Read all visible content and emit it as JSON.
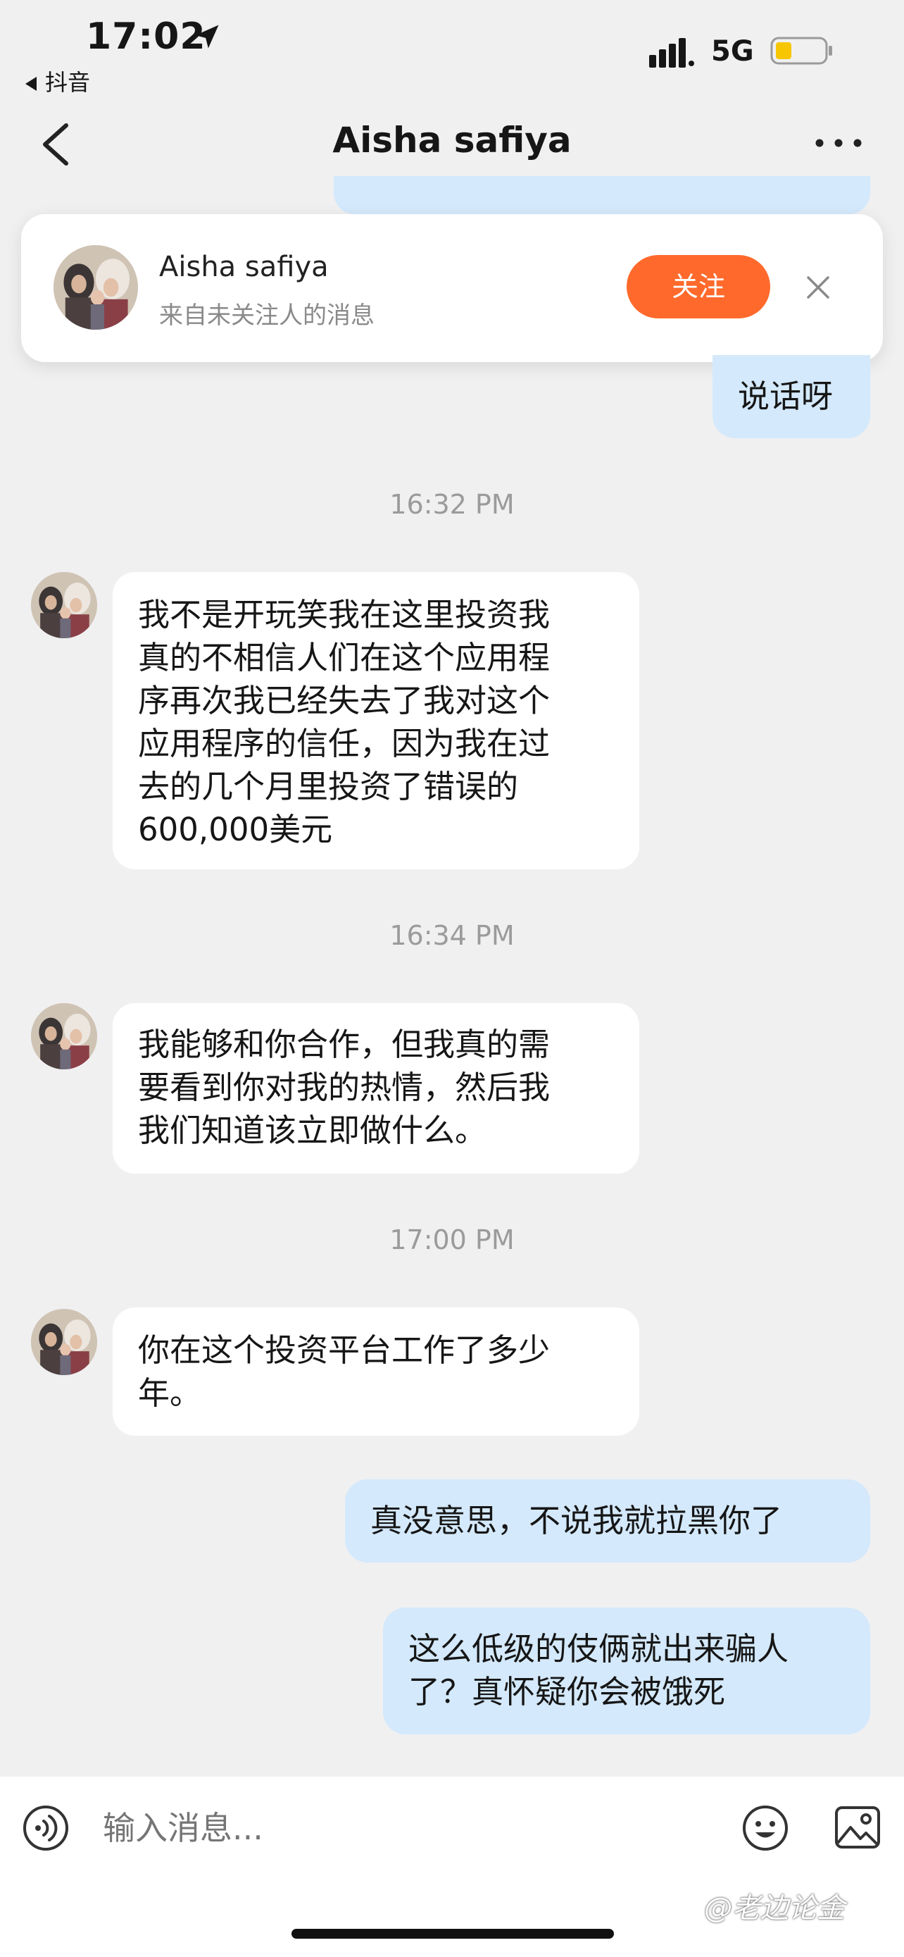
{
  "status_bar": {
    "time": "17:02",
    "back_to_app": "抖音",
    "network": "5G",
    "icons": [
      "location-arrow-icon",
      "signal-icon",
      "battery-icon"
    ]
  },
  "nav": {
    "title": "Aisha safiya",
    "icons": [
      "back-chevron-icon",
      "more-dots-icon"
    ]
  },
  "banner": {
    "name": "Aisha safiya",
    "subtitle": "来自未关注人的消息",
    "follow_label": "关注"
  },
  "messages": [
    {
      "type": "outgoing",
      "text": "说话呀"
    },
    {
      "type": "timestamp",
      "text": "16:32 PM"
    },
    {
      "type": "incoming",
      "text": "我不是开玩笑我在这里投资我\n真的不相信人们在这个应用程\n序再次我已经失去了我对这个\n应用程序的信任，因为我在过\n去的几个月里投资了错误的\n600,000美元"
    },
    {
      "type": "timestamp",
      "text": "16:34 PM"
    },
    {
      "type": "incoming",
      "text": "我能够和你合作，但我真的需\n要看到你对我的热情，然后我\n我们知道该立即做什么。"
    },
    {
      "type": "timestamp",
      "text": "17:00 PM"
    },
    {
      "type": "incoming",
      "text": "你在这个投资平台工作了多少\n年。"
    },
    {
      "type": "outgoing",
      "text": "真没意思，不说我就拉黑你了"
    },
    {
      "type": "outgoing",
      "text": "这么低级的伎俩就出来骗人\n了？真怀疑你会被饿死"
    }
  ],
  "input": {
    "placeholder": "输入消息..."
  },
  "watermark": "@老边论金",
  "colors": {
    "background": "#f0f0f1",
    "outgoing_bubble": "#d4e9fb",
    "incoming_bubble": "#ffffff",
    "follow_button": "#ff6a2c",
    "battery_level": "#f7c600"
  }
}
